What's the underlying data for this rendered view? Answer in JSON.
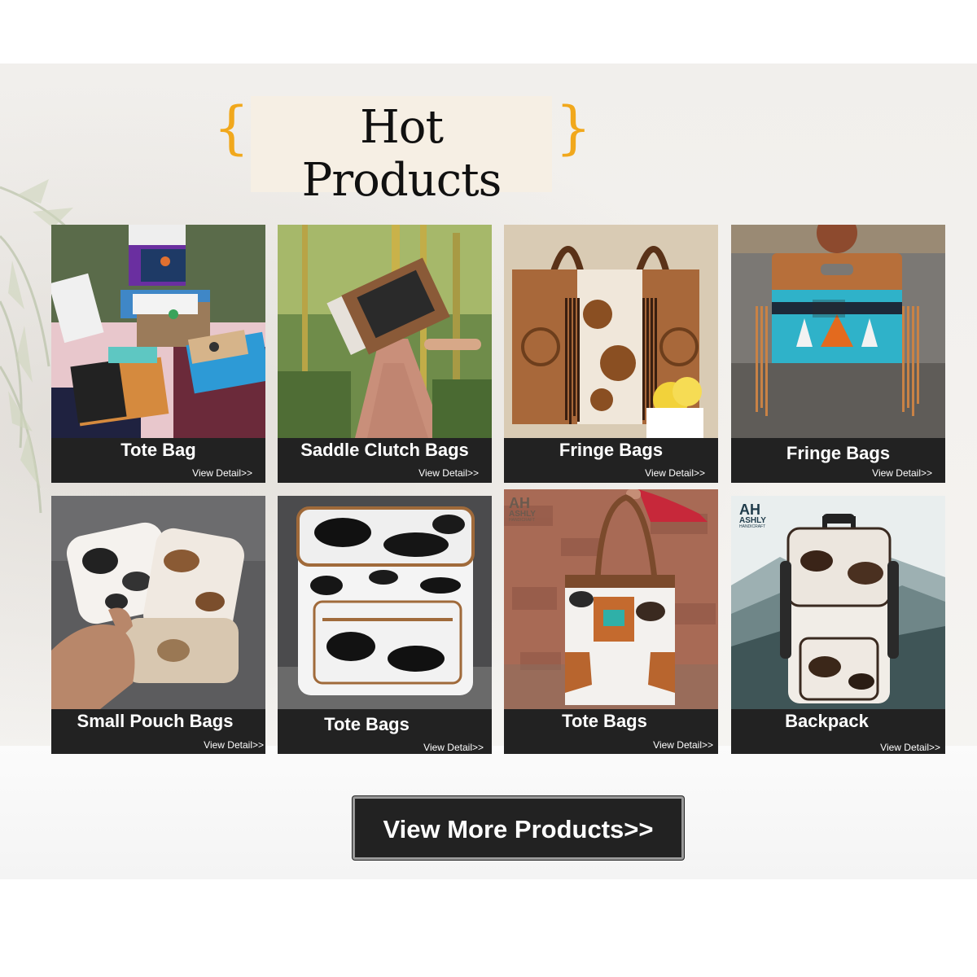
{
  "section": {
    "title": "Hot Products",
    "brace_left": "{",
    "brace_right": "}",
    "accent_color": "#f1a81c"
  },
  "products": [
    {
      "name": "Tote Bag",
      "detail": "View Detail>>",
      "photo": "multicolor-wallets"
    },
    {
      "name": "Saddle Clutch Bags",
      "detail": "View Detail>>",
      "photo": "clutch-held-garden-path"
    },
    {
      "name": "Fringe Bags",
      "detail": "View Detail>>",
      "photo": "tooled-leather-fringe-tote"
    },
    {
      "name": "Fringe Bags",
      "detail": "View Detail>>",
      "photo": "saddle-blanket-fringe-bag"
    },
    {
      "name": "Small Pouch Bags",
      "detail": "View Detail>>",
      "photo": "cowhide-pouches-in-hand"
    },
    {
      "name": "Tote Bags",
      "detail": "View Detail>>",
      "photo": "black-white-cowhide-backpack"
    },
    {
      "name": "Tote Bags",
      "detail": "View Detail>>",
      "photo": "cowhide-tote-brick-wall"
    },
    {
      "name": "Backpack",
      "detail": "View Detail>>",
      "photo": "cowhide-backpack-mountains"
    }
  ],
  "logos": {
    "monogram": "AH",
    "brand": "ASHLY",
    "sub": "HANDICRAFT"
  },
  "cta": {
    "label": "View More Products>>"
  },
  "colors": {
    "bar": "#222222",
    "title_bg": "#f6efe4",
    "button_border": "#9a9a9a"
  }
}
